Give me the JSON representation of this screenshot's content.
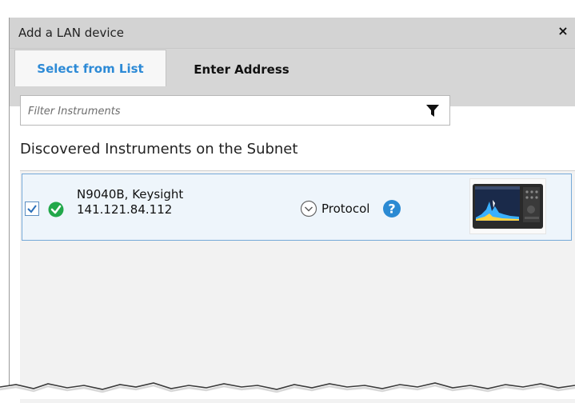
{
  "dialog": {
    "title": "Add a LAN device",
    "close_glyph": "×"
  },
  "tabs": [
    {
      "label": "Select from List",
      "active": true
    },
    {
      "label": "Enter Address",
      "active": false
    }
  ],
  "filter": {
    "placeholder": "Filter Instruments",
    "value": "",
    "icon": "filter-icon"
  },
  "list": {
    "heading": "Discovered Instruments on the Subnet",
    "items": [
      {
        "name": "N9040B, Keysight",
        "address": "141.121.84.112",
        "checked": true,
        "status": "ok",
        "protocol_label": "Protocol"
      }
    ]
  },
  "colors": {
    "accent": "#2d8ad6",
    "status_ok": "#22a84a",
    "row_border": "#76a9d8",
    "titlebar": "#d3d3d3"
  }
}
